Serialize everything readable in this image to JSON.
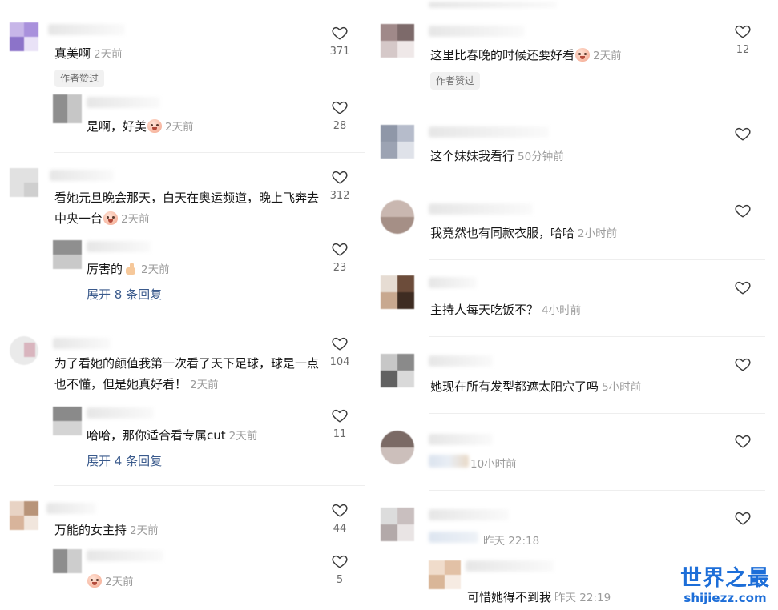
{
  "left": {
    "comments": [
      {
        "text": "真美啊",
        "time": "2天前",
        "likes": "371",
        "badge": "作者赞过",
        "reply": {
          "text": "是啊，好美",
          "time": "2天前",
          "likes": "28"
        }
      },
      {
        "text": "看她元旦晚会那天，白天在奥运频道，晚上飞奔去中央一台",
        "time": "2天前",
        "likes": "312",
        "reply": {
          "text": "厉害的",
          "time": "2天前",
          "likes": "23"
        },
        "more": "展开 8 条回复"
      },
      {
        "text": "为了看她的颜值我第一次看了天下足球，球是一点也不懂，但是她真好看！",
        "time": "2天前",
        "likes": "104",
        "reply": {
          "text": "哈哈，那你适合看专属cut",
          "time": "2天前",
          "likes": "11"
        },
        "more": "展开 4 条回复"
      },
      {
        "text": "万能的女主持",
        "time": "2天前",
        "likes": "44",
        "reply": {
          "text": "",
          "time": "2天前",
          "likes": "5"
        }
      }
    ]
  },
  "right": {
    "comments": [
      {
        "text": "这里比春晚的时候还要好看",
        "time": "2天前",
        "likes": "12",
        "badge": "作者赞过"
      },
      {
        "text": "这个妹妹我看行",
        "time": "50分钟前",
        "likes": ""
      },
      {
        "text": "我竟然也有同款衣服，哈哈",
        "time": "2小时前",
        "likes": ""
      },
      {
        "text": "主持人每天吃饭不？",
        "time": "4小时前",
        "likes": ""
      },
      {
        "text": "她现在所有发型都遮太阳穴了吗",
        "time": "5小时前",
        "likes": ""
      },
      {
        "text": "",
        "time": "10小时前",
        "likes": ""
      },
      {
        "text": "",
        "time": "昨天 22:18",
        "likes": "",
        "reply": {
          "text": "可惜她得不到我",
          "time": "昨天 22:19"
        }
      }
    ]
  },
  "watermark": {
    "title": "世界之最",
    "url": "shijiezz.com"
  },
  "colors": {
    "text": "#161616",
    "time": "#9b9b9b",
    "link": "#3a5a8c",
    "watermark": "#1d6ed8"
  }
}
